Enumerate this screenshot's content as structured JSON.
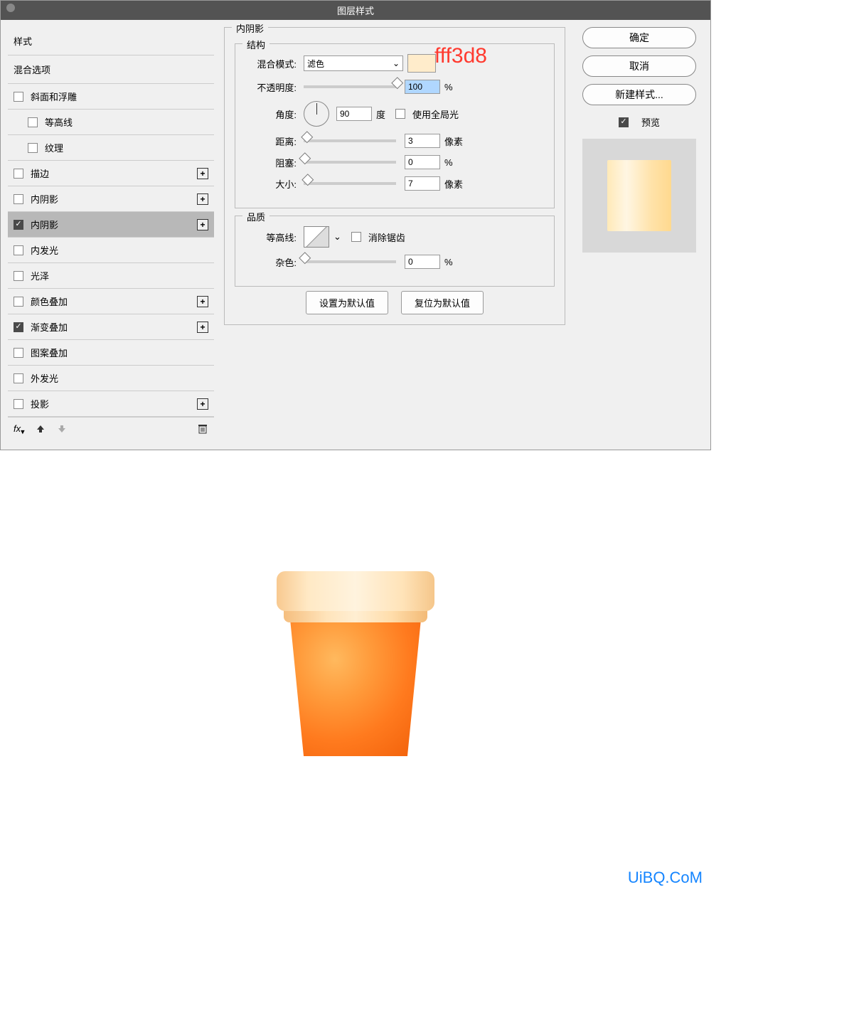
{
  "titlebar": "图层样式",
  "left": {
    "styles_header": "样式",
    "blend_options": "混合选项",
    "items": [
      {
        "label": "斜面和浮雕",
        "checked": false,
        "plus": false,
        "indent": false
      },
      {
        "label": "等高线",
        "checked": false,
        "plus": false,
        "indent": true
      },
      {
        "label": "纹理",
        "checked": false,
        "plus": false,
        "indent": true
      },
      {
        "label": "描边",
        "checked": false,
        "plus": true,
        "indent": false
      },
      {
        "label": "内阴影",
        "checked": false,
        "plus": true,
        "indent": false
      },
      {
        "label": "内阴影",
        "checked": true,
        "plus": true,
        "indent": false,
        "selected": true
      },
      {
        "label": "内发光",
        "checked": false,
        "plus": false,
        "indent": false
      },
      {
        "label": "光泽",
        "checked": false,
        "plus": false,
        "indent": false
      },
      {
        "label": "颜色叠加",
        "checked": false,
        "plus": true,
        "indent": false
      },
      {
        "label": "渐变叠加",
        "checked": true,
        "plus": true,
        "indent": false
      },
      {
        "label": "图案叠加",
        "checked": false,
        "plus": false,
        "indent": false
      },
      {
        "label": "外发光",
        "checked": false,
        "plus": false,
        "indent": false
      },
      {
        "label": "投影",
        "checked": false,
        "plus": true,
        "indent": false
      }
    ],
    "fx": "fx"
  },
  "center": {
    "panel_title": "内阴影",
    "structure_title": "结构",
    "blend_mode_label": "混合模式:",
    "blend_mode_value": "滤色",
    "color_swatch": "#ffeccb",
    "opacity_label": "不透明度:",
    "opacity_value": "100",
    "opacity_unit": "%",
    "angle_label": "角度:",
    "angle_value": "90",
    "angle_unit": "度",
    "global_light": "使用全局光",
    "distance_label": "距离:",
    "distance_value": "3",
    "distance_unit": "像素",
    "choke_label": "阻塞:",
    "choke_value": "0",
    "choke_unit": "%",
    "size_label": "大小:",
    "size_value": "7",
    "size_unit": "像素",
    "quality_title": "品质",
    "contour_label": "等高线:",
    "antialias": "消除锯齿",
    "noise_label": "杂色:",
    "noise_value": "0",
    "noise_unit": "%",
    "set_default": "设置为默认值",
    "reset_default": "复位为默认值"
  },
  "right": {
    "ok": "确定",
    "cancel": "取消",
    "new_style": "新建样式...",
    "preview_label": "预览"
  },
  "annotation": "fff3d8",
  "watermark": "UiBQ.CoM"
}
